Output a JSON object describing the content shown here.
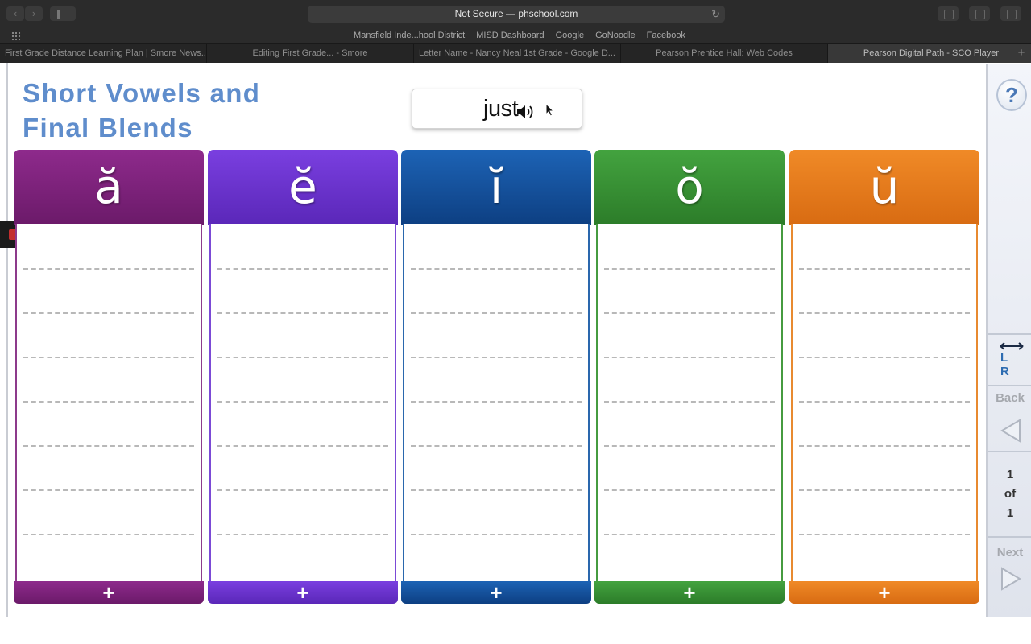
{
  "browser": {
    "url": "Not Secure — phschool.com",
    "bookmarks": [
      "Mansfield Inde...hool District",
      "MISD Dashboard",
      "Google",
      "GoNoodle",
      "Facebook"
    ],
    "tabs": [
      "First Grade Distance Learning Plan | Smore News...",
      "Editing First Grade... - Smore",
      "Letter Name - Nancy Neal 1st Grade - Google D...",
      "Pearson Prentice Hall: Web Codes",
      "Pearson Digital Path - SCO Player"
    ],
    "active_tab": 4
  },
  "activity": {
    "title_line1": "Short Vowels and",
    "title_line2": "Final Blends",
    "word": "just",
    "columns": [
      {
        "vowel": "ă",
        "color": "#8e2a8c",
        "color_dark": "#6b1a69",
        "border": "#8d3a8b",
        "add": "+"
      },
      {
        "vowel": "ĕ",
        "color": "#7a3fe0",
        "color_dark": "#5a27b8",
        "border": "#7b4ad6",
        "add": "+"
      },
      {
        "vowel": "ĭ",
        "color": "#1d63b5",
        "color_dark": "#0d3f82",
        "border": "#2a67ad",
        "add": "+"
      },
      {
        "vowel": "ŏ",
        "color": "#43a33f",
        "color_dark": "#2c7c29",
        "border": "#469b40",
        "add": "+"
      },
      {
        "vowel": "ŭ",
        "color": "#f08a27",
        "color_dark": "#d86b12",
        "border": "#e88a30",
        "add": "+"
      }
    ]
  },
  "panel": {
    "help": "?",
    "lr_label": "L R",
    "back": "Back",
    "page_current": "1",
    "page_of": "of",
    "page_total": "1",
    "next": "Next"
  }
}
